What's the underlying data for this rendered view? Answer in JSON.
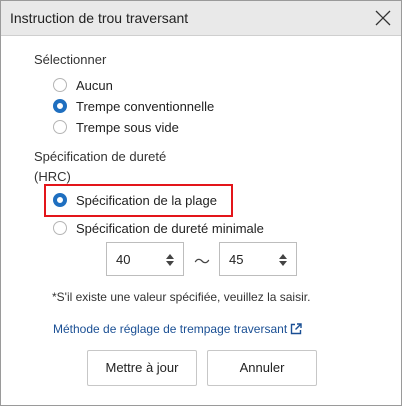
{
  "dialog": {
    "title": "Instruction de trou traversant",
    "close_icon": "close-icon"
  },
  "selection": {
    "heading": "Sélectionner",
    "options": [
      {
        "label": "Aucun",
        "checked": false
      },
      {
        "label": "Trempe conventionnelle",
        "checked": true
      },
      {
        "label": "Trempe sous vide",
        "checked": false
      }
    ]
  },
  "hardness": {
    "heading": "Spécification de dureté",
    "unit": "(HRC)",
    "options": [
      {
        "label": "Spécification de la plage",
        "checked": true
      },
      {
        "label": "Spécification de dureté minimale",
        "checked": false
      }
    ],
    "range_min": "40",
    "range_separator": "～",
    "range_max": "45",
    "highlight_color": "#e3151a"
  },
  "note": "*S'il existe une valeur spécifiée, veuillez la saisir.",
  "link": {
    "label": "Méthode de réglage de trempage traversant",
    "icon": "external-link-icon"
  },
  "buttons": {
    "update": "Mettre à jour",
    "cancel": "Annuler"
  },
  "colors": {
    "accent": "#1f6fc0",
    "link": "#1a4f94"
  }
}
